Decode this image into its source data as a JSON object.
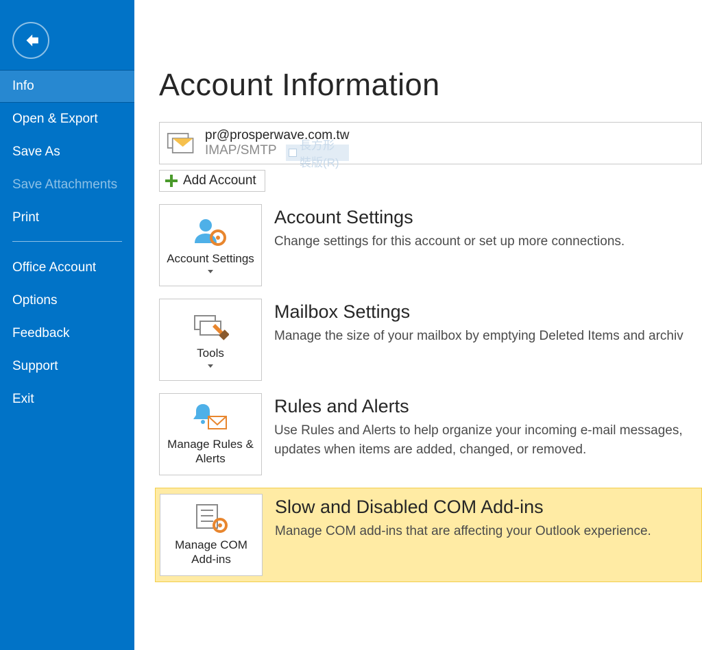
{
  "sidebar": {
    "items": [
      {
        "label": "Info"
      },
      {
        "label": "Open & Export"
      },
      {
        "label": "Save As"
      },
      {
        "label": "Save Attachments"
      },
      {
        "label": "Print"
      },
      {
        "label": "Office Account"
      },
      {
        "label": "Options"
      },
      {
        "label": "Feedback"
      },
      {
        "label": "Support"
      },
      {
        "label": "Exit"
      }
    ]
  },
  "page": {
    "title": "Account Information"
  },
  "account": {
    "email": "pr@prosperwave.com.tw",
    "protocol": "IMAP/SMTP",
    "ghost": "長方形裝版(R)",
    "add_label": "Add Account"
  },
  "sections": [
    {
      "button_label": "Account Settings",
      "title": "Account Settings",
      "desc": "Change settings for this account or set up more connections."
    },
    {
      "button_label": "Tools",
      "title": "Mailbox Settings",
      "desc": "Manage the size of your mailbox by emptying Deleted Items and archiv"
    },
    {
      "button_label": "Manage Rules & Alerts",
      "title": "Rules and Alerts",
      "desc": "Use Rules and Alerts to help organize your incoming e-mail messages, updates when items are added, changed, or removed."
    },
    {
      "button_label": "Manage COM Add-ins",
      "title": "Slow and Disabled COM Add-ins",
      "desc": "Manage COM add-ins that are affecting your Outlook experience."
    }
  ]
}
